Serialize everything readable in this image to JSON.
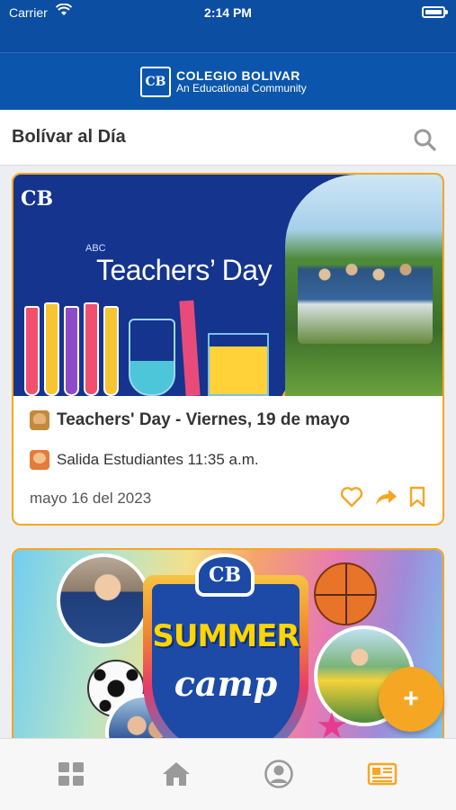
{
  "status_bar": {
    "carrier": "Carrier",
    "time": "2:14 PM"
  },
  "header": {
    "logo_initials": "CB",
    "logo_name": "COLEGIO BOLIVAR",
    "logo_tagline": "An Educational Community"
  },
  "page": {
    "title": "Bolívar al Día"
  },
  "icons": {
    "search": "search-icon",
    "like": "heart-icon",
    "share": "share-arrow-icon",
    "bookmark": "bookmark-icon",
    "fab": "plus-icon",
    "tabs": [
      "grid-icon",
      "home-icon",
      "profile-icon",
      "newspaper-icon"
    ]
  },
  "colors": {
    "brand_blue": "#0b4ea2",
    "accent_orange": "#f5a623",
    "inactive_gray": "#9a9a9a"
  },
  "posts": [
    {
      "banner_logo": "CB",
      "banner_title": "Teachers’ Day",
      "banner_abc": "ABC",
      "headline_emoji": "teacher-emoji-icon",
      "headline": "Teachers' Day - Viernes, 19 de mayo",
      "sub_emoji": "student-emoji-icon",
      "subtext": "Salida Estudiantes 11:35 a.m.",
      "date": "mayo 16 del 2023"
    },
    {
      "banner_logo": "CB",
      "banner_title_line1": "SUMMER",
      "banner_title_line2": "camp"
    }
  ],
  "fab": {
    "label": "+"
  }
}
